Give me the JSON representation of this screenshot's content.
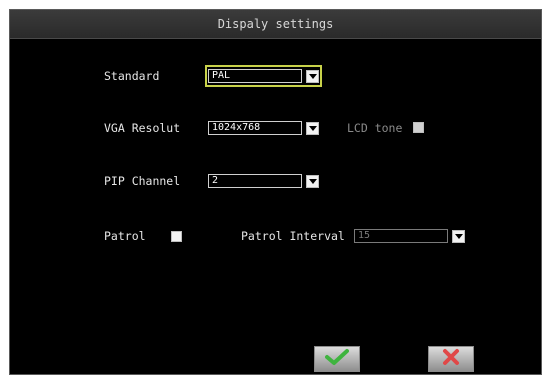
{
  "dialog": {
    "title": "Dispaly settings"
  },
  "standard": {
    "label": "Standard",
    "value": "PAL"
  },
  "vga": {
    "label": "VGA Resolut",
    "value": "1024x768"
  },
  "lcd_tone": {
    "label": "LCD tone",
    "checked": false
  },
  "pip": {
    "label": "PIP Channel",
    "value": "2"
  },
  "patrol": {
    "label": "Patrol",
    "checked": false
  },
  "patrol_interval": {
    "label": "Patrol Interval",
    "value": "15"
  },
  "buttons": {
    "ok_icon": "check-icon",
    "cancel_icon": "x-icon"
  },
  "colors": {
    "background": "#000000",
    "titlebar": "#333333",
    "focus": "#c8d24a",
    "ok": "#3fb43f",
    "cancel": "#e04848"
  }
}
